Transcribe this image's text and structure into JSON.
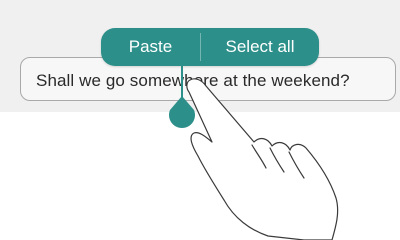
{
  "context_menu": {
    "paste_label": "Paste",
    "select_all_label": "Select all"
  },
  "text_input": {
    "value": "Shall we go somewhere at the weekend?"
  },
  "colors": {
    "accent": "#2c8f8a",
    "input_background": "#f7f7f7",
    "input_border": "#a9a9a9",
    "backdrop": "#f0f0f0"
  },
  "icons": {
    "cursor_handle": "teardrop-handle-icon",
    "hand": "pointing-hand-icon"
  }
}
